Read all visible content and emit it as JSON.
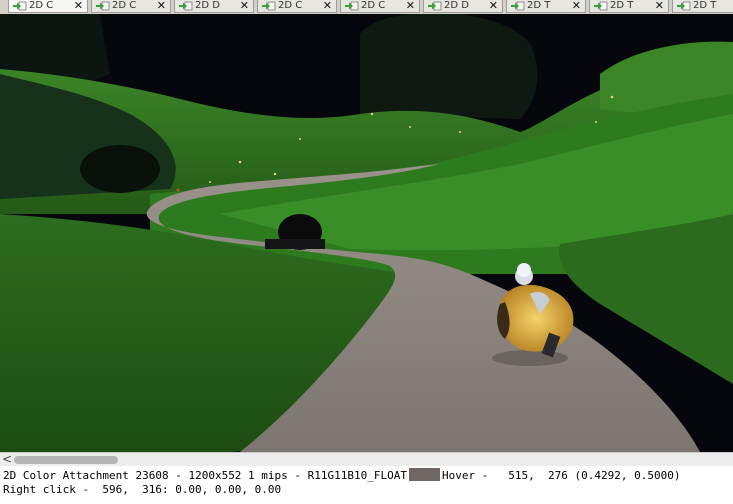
{
  "tabs": [
    {
      "label": "2D C",
      "active": true
    },
    {
      "label": "2D C",
      "active": false
    },
    {
      "label": "2D D",
      "active": false
    },
    {
      "label": "2D C",
      "active": false
    },
    {
      "label": "2D C",
      "active": false
    },
    {
      "label": "2D D",
      "active": false
    },
    {
      "label": "2D T",
      "active": false
    },
    {
      "label": "2D T",
      "active": false
    },
    {
      "label": "2D T",
      "active": false
    }
  ],
  "tab_close_glyph": "✕",
  "scrollbar": {
    "left_arrow": "<"
  },
  "status": {
    "texture": "2D Color Attachment 23608",
    "dims": "1200x552 1 mips",
    "format": "R11G11B10_FLOAT",
    "swatch_color": "#6e6764",
    "hover_label": "Hover -",
    "hover_value": "515,  276 (0.4292, 0.5000)",
    "right_click_label": "Right click -",
    "right_click_value": "596,  316: 0.00, 0.00, 0.00"
  },
  "colors": {
    "tab_icon": "#3aa03a",
    "sky": "#05070c",
    "grass_dark": "#1c4a12",
    "grass": "#2f7a20",
    "grass_light": "#4c9a34",
    "path": "#8d8680"
  },
  "icons": {
    "tab_icon": "green-arrow-document-icon",
    "close": "close-icon"
  }
}
